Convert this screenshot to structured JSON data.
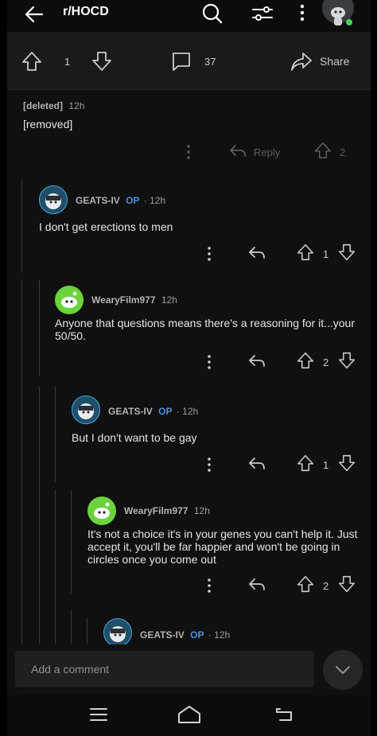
{
  "header": {
    "subreddit": "r/HOCD"
  },
  "post_actions": {
    "votes": "1",
    "comments": "37",
    "share_label": "Share"
  },
  "comments": [
    {
      "author": "[deleted]",
      "op": "",
      "time": "12h",
      "body": "[removed]",
      "votes": "2",
      "reply_label": "Reply"
    },
    {
      "author": "GEATS-IV",
      "op": "OP",
      "time": "· 12h",
      "body": "I don't get erections to men",
      "votes": "1"
    },
    {
      "author": "WearyFilm977",
      "op": "",
      "time": "12h",
      "body": "Anyone that questions means there's a reasoning for it...your 50/50.",
      "votes": "2"
    },
    {
      "author": "GEATS-IV",
      "op": "OP",
      "time": "· 12h",
      "body": "But I don't want to be gay",
      "votes": "1"
    },
    {
      "author": "WearyFilm977",
      "op": "",
      "time": "12h",
      "body": "It's not a choice it's in your genes you can't help it. Just accept it, you'll be far happier and won't be going in circles once you come out",
      "votes": "2"
    },
    {
      "author": "GEATS-IV",
      "op": "OP",
      "time": "· 12h",
      "body": "",
      "votes": ""
    }
  ],
  "composer": {
    "placeholder": "Add a comment"
  },
  "icons": [
    "back-arrow-icon",
    "search-icon",
    "filter-icon",
    "more-vertical-icon",
    "snoo-avatar-icon",
    "upvote-icon",
    "downvote-icon",
    "comment-icon",
    "share-icon",
    "reply-icon",
    "chevron-down-icon",
    "menu-icon",
    "home-icon",
    "back-nav-icon"
  ],
  "colors": {
    "op": "#4a90e2",
    "online": "#46d160",
    "avatar_green": "#6bd33c",
    "background": "#101010"
  }
}
